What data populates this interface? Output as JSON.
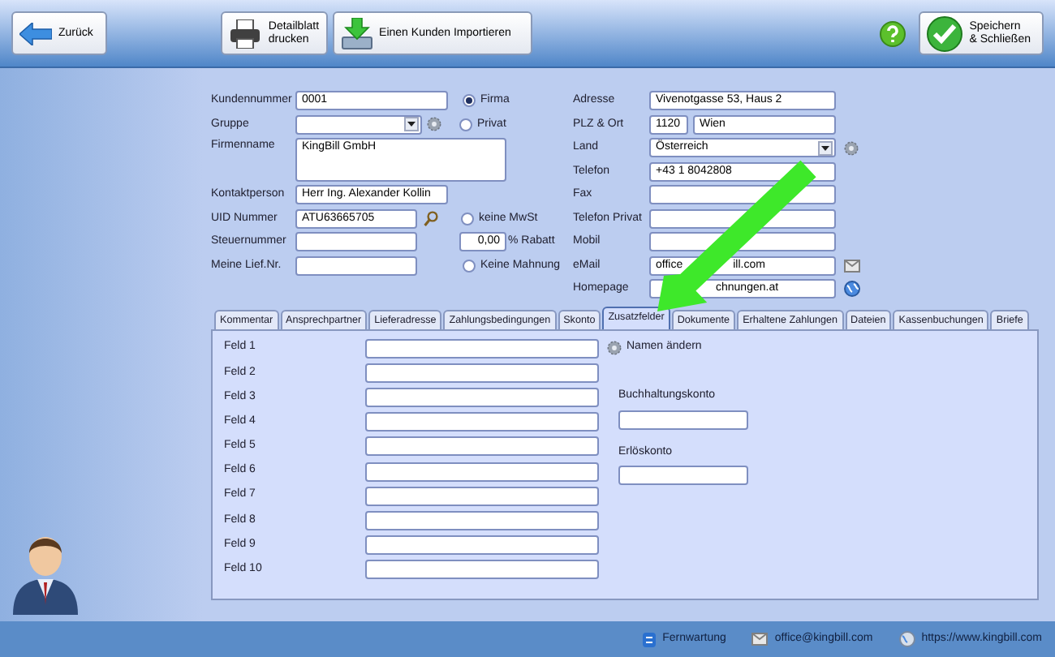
{
  "toolbar": {
    "back": "Zurück",
    "print": "Detailblatt\ndrucken",
    "import": "Einen Kunden Importieren",
    "save": "Speichern\n& Schließen"
  },
  "customer_type": [
    {
      "label": "Firma",
      "selected": true
    },
    {
      "label": "Privat",
      "selected": false
    }
  ],
  "left_fields": {
    "kundennummer": {
      "label": "Kundennummer",
      "value": "0001"
    },
    "gruppe": {
      "label": "Gruppe"
    },
    "firmenname": {
      "label": "Firmenname",
      "value": "KingBill GmbH"
    },
    "kontaktperson": {
      "label": "Kontaktperson",
      "value": "Herr Ing. Alexander Kollin"
    },
    "uid": {
      "label": "UID Nummer",
      "value": "ATU63665705"
    },
    "steuernummer": {
      "label": "Steuernummer"
    },
    "lief_nr": {
      "label": "Meine Lief.Nr."
    }
  },
  "keine_mwst": {
    "label": "keine MwSt",
    "checked": false
  },
  "rabatt": {
    "value": "0,00",
    "label": "% Rabatt"
  },
  "keine_mahnung": {
    "label": "Keine Mahnung",
    "checked": false
  },
  "right_fields": {
    "adresse": {
      "label": "Adresse",
      "value": "Vivenotgasse 53, Haus 2"
    },
    "plz_ort": {
      "label": "PLZ & Ort",
      "plz": "1120",
      "ort": "Wien"
    },
    "land": {
      "label": "Land",
      "value": "Österreich"
    },
    "telefon": {
      "label": "Telefon",
      "value": "+43 1 8042808"
    },
    "fax": {
      "label": "Fax"
    },
    "telefon_privat": {
      "label": "Telefon Privat"
    },
    "mobil": {
      "label": "Mobil"
    },
    "email": {
      "label": "eMail",
      "visible_parts": [
        "office",
        "ill.com"
      ]
    },
    "homepage": {
      "label": "Homepage",
      "visible_part": "chnungen.at"
    }
  },
  "tabs": [
    {
      "label": "Kommentar",
      "selected": false
    },
    {
      "label": "Ansprechpartner",
      "selected": false
    },
    {
      "label": "Lieferadresse",
      "selected": false
    },
    {
      "label": "Zahlungsbedingungen",
      "selected": false
    },
    {
      "label": "Skonto",
      "selected": false
    },
    {
      "label": "Zusatzfelder",
      "selected": true
    },
    {
      "label": "Dokumente",
      "selected": false
    },
    {
      "label": "Erhaltene Zahlungen",
      "selected": false
    },
    {
      "label": "Dateien",
      "selected": false
    },
    {
      "label": "Kassenbuchungen",
      "selected": false
    },
    {
      "label": "Briefe",
      "selected": false
    }
  ],
  "extra_fields": [
    "Feld 1",
    "Feld 2",
    "Feld 3",
    "Feld 4",
    "Feld 5",
    "Feld 6",
    "Feld 7",
    "Feld 8",
    "Feld 9",
    "Feld 10"
  ],
  "rename_button": "Namen ändern",
  "buchhaltungskonto": "Buchhaltungskonto",
  "erloeskonto": "Erlöskonto",
  "status_bar": [
    "Fernwartung",
    "office@kingbill.com",
    "https://www.kingbill.com"
  ]
}
